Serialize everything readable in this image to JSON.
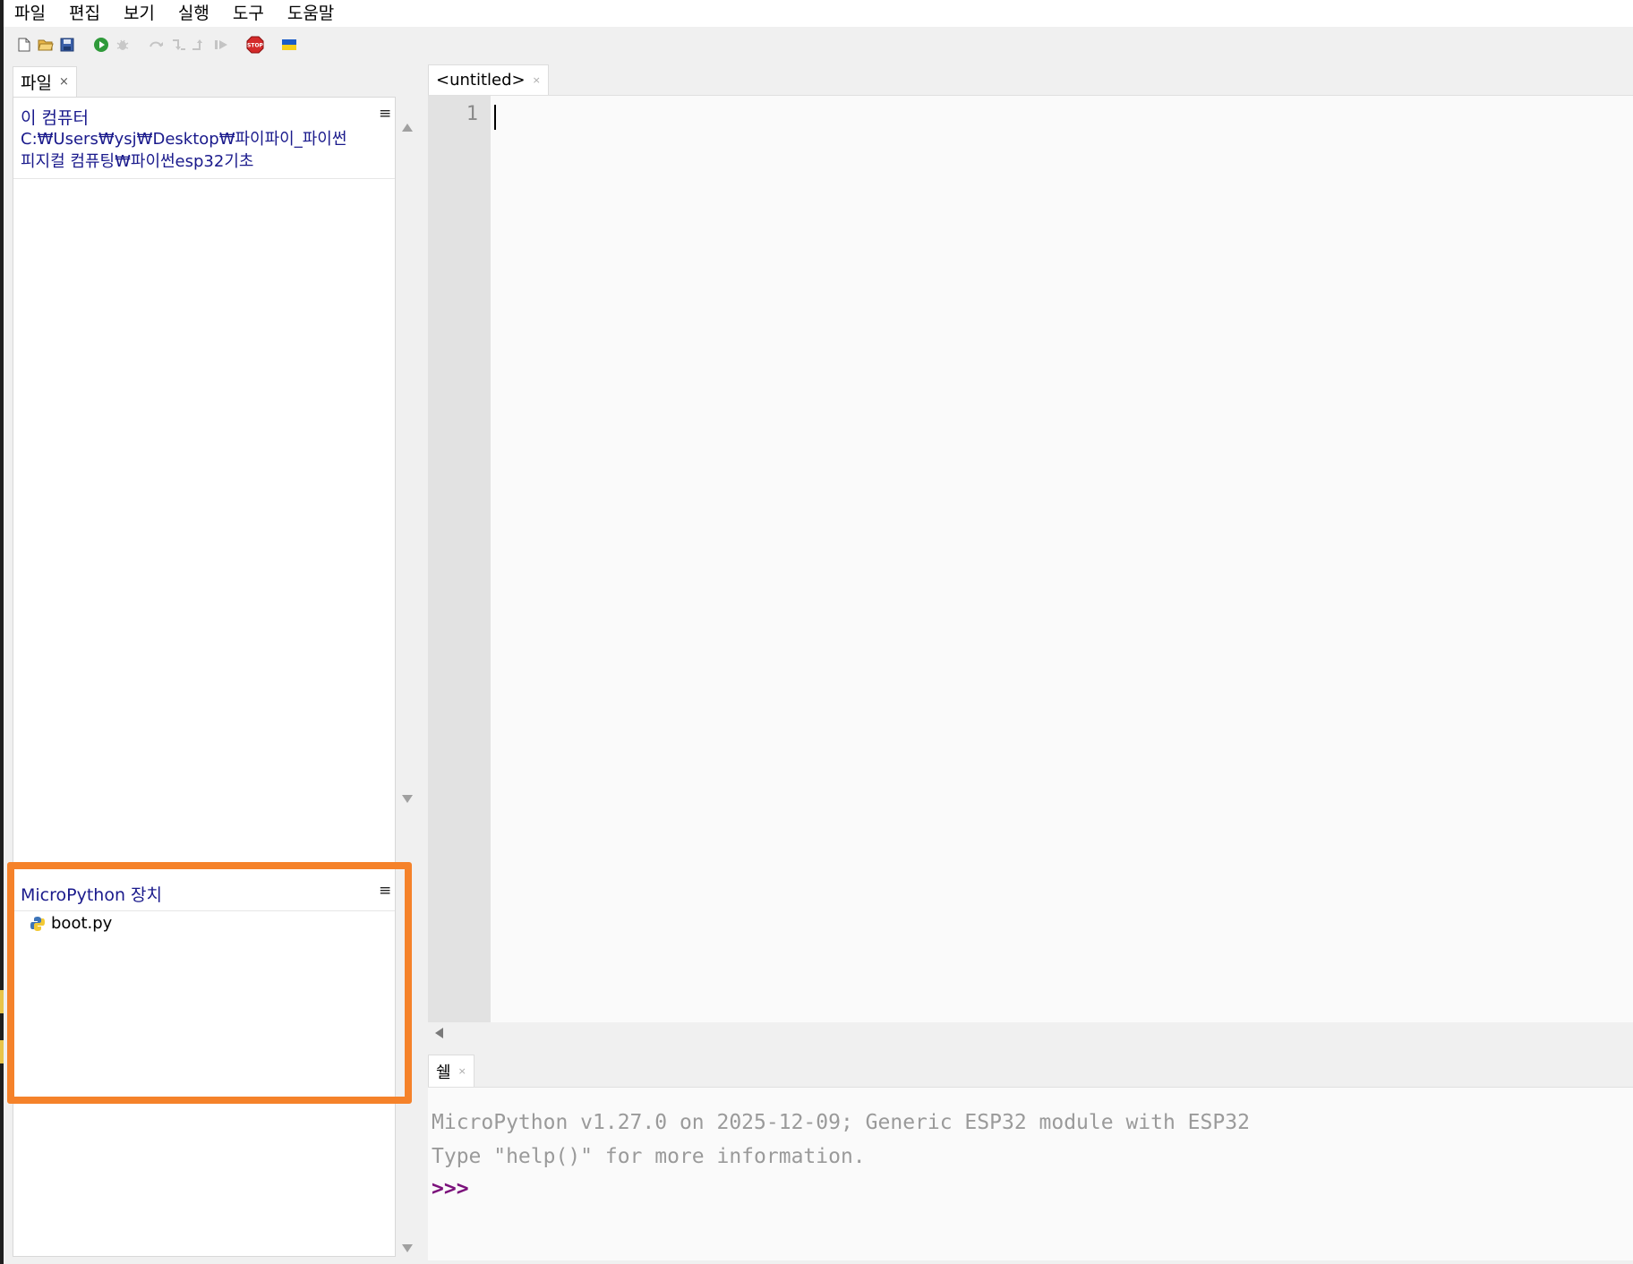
{
  "menubar": {
    "items": [
      "파일",
      "편집",
      "보기",
      "실행",
      "도구",
      "도움말"
    ]
  },
  "toolbar": {
    "buttons": [
      {
        "icon": "new-file-icon"
      },
      {
        "icon": "open-folder-icon"
      },
      {
        "icon": "save-icon"
      },
      {
        "icon": "run-icon"
      },
      {
        "icon": "debug-icon"
      },
      {
        "icon": "step-over-icon"
      },
      {
        "icon": "step-into-icon"
      },
      {
        "icon": "step-out-icon"
      },
      {
        "icon": "resume-icon"
      },
      {
        "icon": "stop-icon",
        "label": "STOP"
      },
      {
        "icon": "ukraine-flag-icon"
      }
    ]
  },
  "files_panel": {
    "tab_label": "파일",
    "tab_close": "×",
    "this_computer": {
      "title": "이 컴퓨터",
      "path_line1": "C:₩Users₩ysj₩Desktop₩파이파이_파이썬",
      "path_line2": "피지컬 컴퓨팅₩파이썬esp32기초",
      "menu_glyph": "≡"
    },
    "device": {
      "title": "MicroPython 장치",
      "menu_glyph": "≡",
      "files": [
        "boot.py"
      ]
    }
  },
  "editor": {
    "tab_label": "<untitled>",
    "tab_close": "×",
    "line_numbers": [
      "1"
    ]
  },
  "shell": {
    "tab_label": "쉘",
    "tab_close": "×",
    "lines": [
      "MicroPython v1.27.0 on 2025-12-09; Generic ESP32 module with ESP32",
      "Type \"help()\" for more information."
    ],
    "prompt": ">>>"
  },
  "colors": {
    "highlight_border": "#f5822a",
    "path_text": "#1a1a8c",
    "prompt": "#7b117b"
  }
}
